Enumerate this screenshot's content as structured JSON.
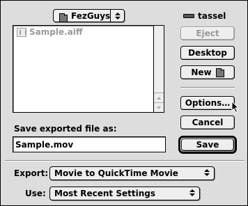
{
  "folder_popup": {
    "label": "FezGuys",
    "icon": "folder-icon"
  },
  "volume": {
    "label": "tassel",
    "icon": "disk-icon"
  },
  "file_list": {
    "items": [
      {
        "name": "Sample.aiff",
        "icon": "sound-file-icon",
        "enabled": false
      }
    ]
  },
  "buttons": {
    "eject": "Eject",
    "desktop": "Desktop",
    "new": "New",
    "options": "Options…",
    "cancel": "Cancel",
    "save": "Save"
  },
  "save_as": {
    "label": "Save exported file as:",
    "value": "Sample.mov"
  },
  "export": {
    "label": "Export:",
    "selected": "Movie to QuickTime Movie"
  },
  "use": {
    "label": "Use:",
    "selected": "Most Recent Settings"
  }
}
